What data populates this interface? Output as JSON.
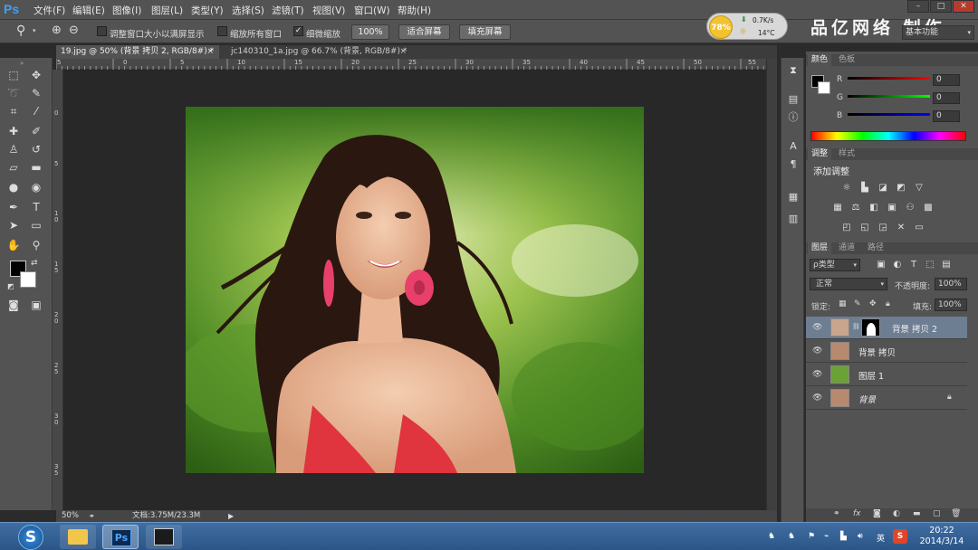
{
  "app": {
    "logo": "Ps"
  },
  "menu": [
    "文件(F)",
    "编辑(E)",
    "图像(I)",
    "图层(L)",
    "类型(Y)",
    "选择(S)",
    "滤镜(T)",
    "视图(V)",
    "窗口(W)",
    "帮助(H)"
  ],
  "window_controls": [
    "–",
    "□",
    "✕"
  ],
  "options": {
    "resize_windows_label": "调整窗口大小以满屏显示",
    "zoom_all_label": "缩放所有窗口",
    "scrubby_label": "细微缩放",
    "btn_100": "100%",
    "btn_fit": "适合屏幕",
    "btn_fill": "填充屏幕"
  },
  "gauge": {
    "percent": "78%",
    "speed": "0.7K/s",
    "temp": "14°C"
  },
  "brand": "品亿网络 制作",
  "workspace": "基本功能",
  "tabs": [
    {
      "label": "19.jpg @ 50% (背景 拷贝 2, RGB/8#) *",
      "close": "×"
    },
    {
      "label": "jc140310_1a.jpg @ 66.7% (背景, RGB/8#) *",
      "close": "×"
    }
  ],
  "ruler_top": [
    "5",
    "0",
    "5",
    "10",
    "15",
    "20",
    "25",
    "30",
    "35",
    "40",
    "45",
    "50",
    "55"
  ],
  "ruler_left": [
    "0",
    "5",
    "1\n0",
    "1\n5",
    "2\n0",
    "2\n5",
    "3\n0",
    "3\n5"
  ],
  "status": {
    "zoom": "50%",
    "doc": "文档:3.75M/23.3M"
  },
  "panels": {
    "color_tabs": [
      "颜色",
      "色板"
    ],
    "color": {
      "r_label": "R",
      "g_label": "G",
      "b_label": "B",
      "r": "0",
      "g": "0",
      "b": "0"
    },
    "adjust_tabs": [
      "调整",
      "样式"
    ],
    "add_adjustment": "添加调整",
    "layers_tabs": [
      "图层",
      "通道",
      "路径"
    ],
    "filter_kind": "ρ类型",
    "blend_mode": "正常",
    "opacity_label": "不透明度:",
    "opacity": "100%",
    "lock_label": "锁定:",
    "fill_label": "填充:",
    "fill": "100%"
  },
  "layers": [
    {
      "name": "背景 拷贝 2",
      "selected": true
    },
    {
      "name": "背景 拷贝",
      "selected": false
    },
    {
      "name": "图层 1",
      "selected": false
    },
    {
      "name": "背景",
      "selected": false
    }
  ],
  "taskbar": {
    "ps_label": "Ps",
    "clock_time": "20:22",
    "clock_date": "2014/3/14",
    "ime": "英"
  }
}
